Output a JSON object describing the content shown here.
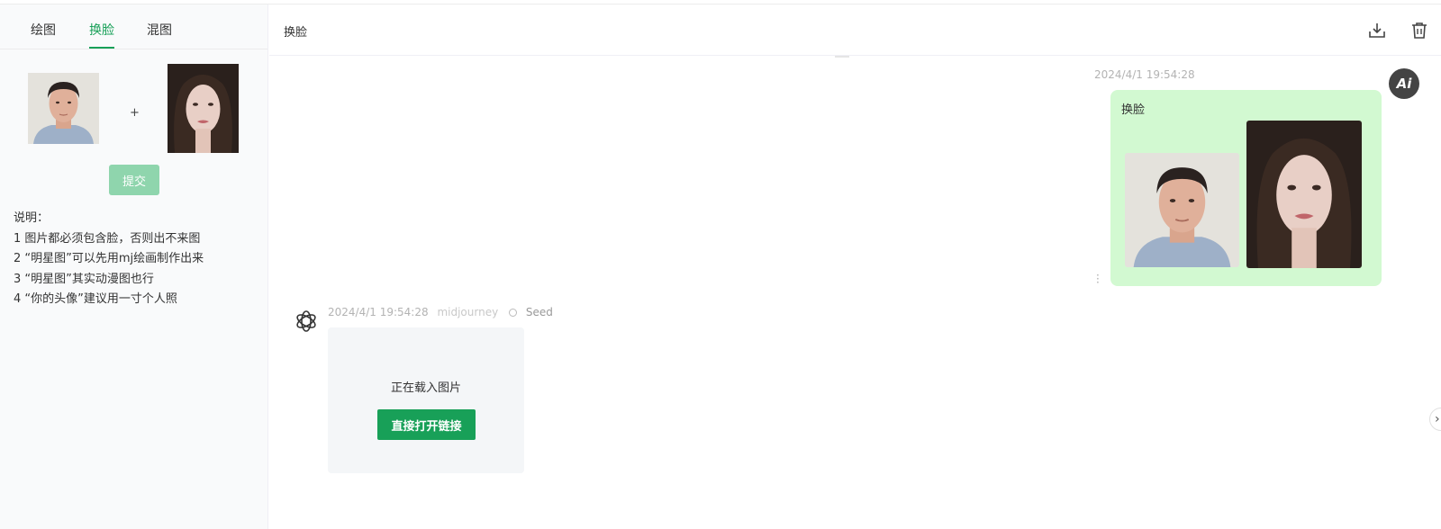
{
  "sidebar": {
    "tabs": [
      {
        "label": "绘图"
      },
      {
        "label": "换脸",
        "active": true
      },
      {
        "label": "混图"
      }
    ],
    "plus": "+",
    "submit_label": "提交",
    "notes": [
      "说明：",
      "1 图片都必须包含脸，否则出不来图",
      "2 “明星图”可以先用mj绘画制作出来",
      "3 “明星图”其实动漫图也行",
      "4 “你的头像”建议用一寸个人照"
    ]
  },
  "header": {
    "title": "换脸",
    "icons": [
      "download-icon",
      "trash-icon"
    ]
  },
  "chat": {
    "user_message": {
      "time": "2024/4/1 19:54:28",
      "text": "换脸",
      "avatar_text": "Ai"
    },
    "bot_message": {
      "time": "2024/4/1 19:54:28",
      "model": "midjourney",
      "seed_label": "Seed",
      "loading_text": "正在载入图片",
      "open_link_label": "直接打开链接"
    },
    "next_arrow": "›"
  },
  "colors": {
    "accent": "#18a058",
    "submit_disabled": "#8fd5ad",
    "user_bubble": "#d2f9d1",
    "bot_bubble": "#f4f6f8"
  }
}
